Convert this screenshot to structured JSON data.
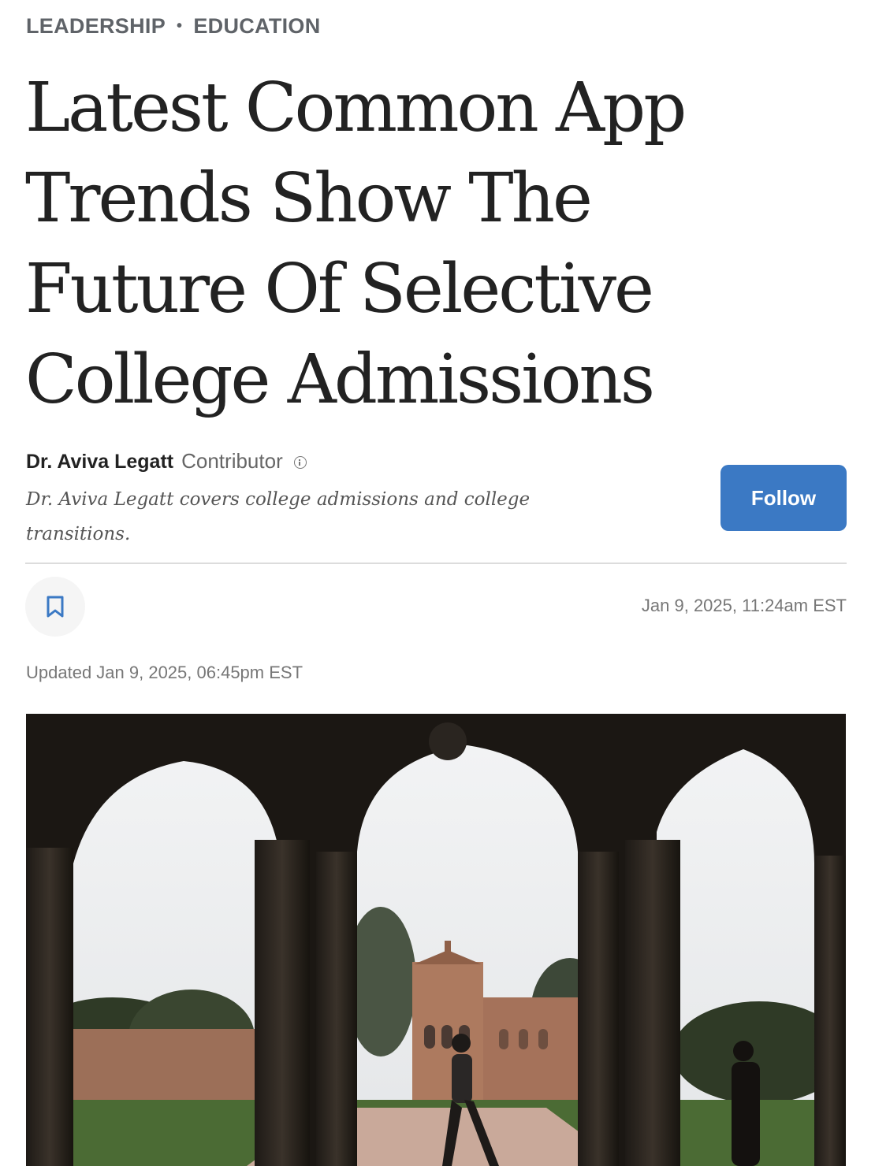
{
  "categories": [
    "LEADERSHIP",
    "EDUCATION"
  ],
  "category_separator": "•",
  "headline": "Latest Common App Trends Show The Future Of Selective College Admissions",
  "author": {
    "name": "Dr. Aviva Legatt",
    "role": "Contributor",
    "bio": "Dr. Aviva Legatt covers college admissions and college transitions.",
    "info_icon": "info-icon"
  },
  "actions": {
    "follow_label": "Follow",
    "bookmark_icon": "bookmark-icon"
  },
  "published": "Jan 9, 2025, 11:24am EST",
  "updated": "Updated Jan 9, 2025, 06:45pm EST",
  "colors": {
    "accent": "#3b79c4",
    "category_text": "#5f6368",
    "meta_text": "#777777"
  }
}
